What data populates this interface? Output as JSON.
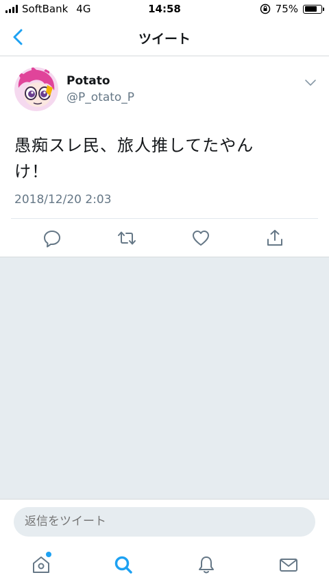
{
  "status_bar": {
    "carrier": "SoftBank",
    "network": "4G",
    "time": "14:58",
    "battery_percent": "75%",
    "battery_level": 0.75
  },
  "nav": {
    "title": "ツイート",
    "back_icon": "chevron-left-icon"
  },
  "tweet": {
    "display_name": "Potato",
    "handle": "@P_otato_P",
    "text_line1": "愚痴スレ民、旅人推してたやん",
    "text_line2": "け！",
    "timestamp": "2018/12/20 2:03",
    "actions": [
      "reply-icon",
      "retweet-icon",
      "like-icon",
      "share-icon"
    ]
  },
  "reply": {
    "placeholder": "返信をツイート"
  },
  "tab_bar": {
    "tabs": [
      "home-icon",
      "search-icon",
      "notifications-icon",
      "messages-icon"
    ],
    "active": "search-icon",
    "accent": "#1da1f2"
  },
  "colors": {
    "accent": "#1da1f2",
    "secondary_text": "#657786",
    "background_grey": "#e6ecf0"
  }
}
